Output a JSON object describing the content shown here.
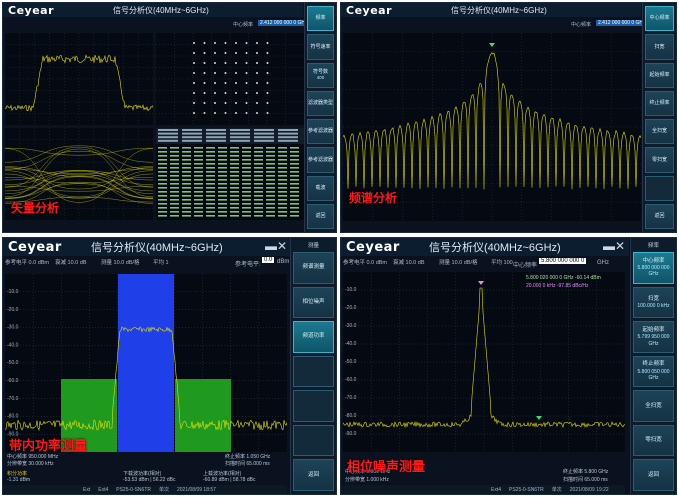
{
  "panels": [
    {
      "logo": "Ceyear",
      "title": "信号分析仪(40MHz~6GHz)",
      "overlay_label": "矢量分析",
      "header_right_label": "中心频率",
      "header_right_value": "2.412 000 000 0 GHz",
      "softkeys": [
        {
          "label": "频率",
          "value": "",
          "active": true
        },
        {
          "label": "符号速率",
          "value": "",
          "active": false
        },
        {
          "label": "符号数",
          "value": "400",
          "active": false
        },
        {
          "label": "滤波器类型",
          "value": "",
          "active": false
        },
        {
          "label": "参考滤波器",
          "value": "",
          "active": false
        },
        {
          "label": "参考滤波器",
          "value": "",
          "active": false
        },
        {
          "label": "载波",
          "value": "",
          "active": false
        },
        {
          "label": "返回",
          "value": "",
          "active": false
        }
      ]
    },
    {
      "logo": "Ceyear",
      "title": "信号分析仪(40MHz~6GHz)",
      "overlay_label": "频谱分析",
      "header_right_label": "中心频率",
      "header_right_value": "2.412 000 000 0 GHz",
      "softkeys": [
        {
          "label": "中心频率",
          "value": "",
          "active": true
        },
        {
          "label": "扫宽",
          "value": "",
          "active": false
        },
        {
          "label": "起始频率",
          "value": "",
          "active": false
        },
        {
          "label": "终止频率",
          "value": "",
          "active": false
        },
        {
          "label": "全扫宽",
          "value": "",
          "active": false
        },
        {
          "label": "零扫宽",
          "value": "",
          "active": false
        },
        {
          "label": "",
          "value": "",
          "active": false
        },
        {
          "label": "返回",
          "value": "",
          "active": false
        }
      ]
    },
    {
      "logo": "Ceyear",
      "title": "信号分析仪(40MHz~6GHz)",
      "overlay_label": "带内功率测量",
      "ref_level_label": "参考电平:",
      "ref_level_value": "0.0",
      "ref_level_unit": "dBm",
      "topbar": [
        "参考电平  0.0 dBm",
        "衰减  10.0 dB",
        "测量  10.0 dB/格",
        "平均  1"
      ],
      "y_ticks": [
        "-10.0",
        "-20.0",
        "-30.0",
        "-40.0",
        "-50.0",
        "-60.0",
        "-70.0",
        "-80.0",
        "-90.0"
      ],
      "bottom_left": "中心频率  950.000 MHz",
      "bottom_left2": "分辨带宽  30.000 kHz",
      "bottom_right": "终止频率  1.050 GHz",
      "bottom_right2": "扫描时间  65.000 ms",
      "result_label": "积分功率",
      "result_value": "-1.31 dBm",
      "result_a_label": "下载波功率(相对)",
      "result_a_value": "-53.53 dBm | 56.22 dBc",
      "result_b_label": "上载波功率(相对)",
      "result_b_value": "-60.89 dBm | 58.78 dBc",
      "status_text": [
        "Ext",
        "Ext4",
        "PS25-0-SN6TR",
        "单次",
        "2021/08/09 18:57"
      ],
      "sidehead": "测量",
      "softkeys": [
        {
          "label": "频谱测量",
          "value": "",
          "active": false
        },
        {
          "label": "相位噪声",
          "value": "",
          "active": false
        },
        {
          "label": "频道功率",
          "value": "",
          "active": true
        },
        {
          "label": "",
          "value": "",
          "active": false
        },
        {
          "label": "",
          "value": "",
          "active": false
        },
        {
          "label": "",
          "value": "",
          "active": false
        },
        {
          "label": "返回",
          "value": "",
          "active": false
        }
      ]
    },
    {
      "logo": "Ceyear",
      "title": "信号分析仪(40MHz~6GHz)",
      "overlay_label": "相位噪声测量",
      "header_right_label": "中心频率",
      "header_right_value": "5.800 000 000 0",
      "header_right_unit": "GHz",
      "topbar": [
        "参考电平  0.0 dBm",
        "衰减  10.0 dB",
        "测量  10.0 dB/格",
        "平均  100"
      ],
      "marker1": "5.800 020 000 0 GHz   -60.14 dBm",
      "marker2": "20.000 0 kHz   -97.85 dBc/Hz",
      "y_ticks": [
        "-10.0",
        "-20.0",
        "-30.0",
        "-40.0",
        "-50.0",
        "-60.0",
        "-70.0",
        "-80.0",
        "-90.0"
      ],
      "bottom_left": "中心频率  5.800 GHz",
      "bottom_left2": "分辨带宽  1.000 kHz",
      "bottom_right": "终止频率  5.800 GHz",
      "bottom_right2": "扫描时间  65.000 ms",
      "status_text": [
        "Ext4",
        "PS25-0-SN6TR",
        "单次",
        "2021/08/09 19:22"
      ],
      "sidehead": "频率",
      "softkeys": [
        {
          "label": "中心频率",
          "value": "5.800 000 000 GHz",
          "active": true
        },
        {
          "label": "扫宽",
          "value": "100.000 0 kHz",
          "active": false
        },
        {
          "label": "起始频率",
          "value": "5.799 950 000 GHz",
          "active": false
        },
        {
          "label": "终止频率",
          "value": "5.800 050 000 GHz",
          "active": false
        },
        {
          "label": "全扫宽",
          "value": "",
          "active": false
        },
        {
          "label": "零扫宽",
          "value": "",
          "active": false
        },
        {
          "label": "返回",
          "value": "",
          "active": false
        }
      ]
    }
  ]
}
